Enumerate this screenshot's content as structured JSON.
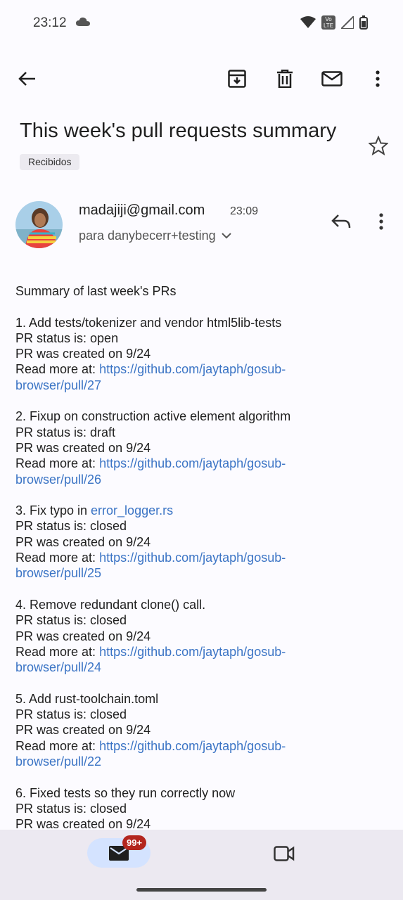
{
  "status_bar": {
    "time": "23:12",
    "volte_label": "Vo LTE"
  },
  "email": {
    "subject": "This week's pull requests summary",
    "label": "Recibidos",
    "sender": "madajiji@gmail.com",
    "time": "23:09",
    "recipient": "para danybecerr+testing"
  },
  "body": {
    "intro": "Summary of last week's PRs",
    "prs": [
      {
        "title": "1. Add tests/tokenizer and vendor html5lib-tests",
        "status": "PR status is: open",
        "created": "PR was created on 9/24",
        "read_more": "Read more at: ",
        "link_line1": "https://github.com/jaytaph/gosub-",
        "link_line2": "browser/pull/27"
      },
      {
        "title": "2. Fixup on construction active element algorithm",
        "status": "PR status is: draft",
        "created": "PR was created on 9/24",
        "read_more": "Read more at: ",
        "link_line1": "https://github.com/jaytaph/gosub-",
        "link_line2": "browser/pull/26"
      },
      {
        "title_prefix": "3. Fix typo in ",
        "title_link": "error_logger.rs",
        "status": "PR status is: closed",
        "created": "PR was created on 9/24",
        "read_more": "Read more at: ",
        "link_line1": "https://github.com/jaytaph/gosub-",
        "link_line2": "browser/pull/25"
      },
      {
        "title": "4. Remove redundant clone() call.",
        "status": "PR status is: closed",
        "created": "PR was created on 9/24",
        "read_more": "Read more at: ",
        "link_line1": "https://github.com/jaytaph/gosub-",
        "link_line2": "browser/pull/24"
      },
      {
        "title": "5. Add rust-toolchain.toml",
        "status": "PR status is: closed",
        "created": "PR was created on 9/24",
        "read_more": "Read more at: ",
        "link_line1": "https://github.com/jaytaph/gosub-",
        "link_line2": "browser/pull/22"
      },
      {
        "title": "6. Fixed tests so they run correctly now",
        "status": "PR status is: closed",
        "created": "PR was created on 9/24"
      }
    ]
  },
  "bottom_nav": {
    "mail_badge": "99+"
  },
  "colors": {
    "link": "#3b74c5",
    "badge": "#b3261e",
    "active_tab": "#d4e3ff"
  }
}
